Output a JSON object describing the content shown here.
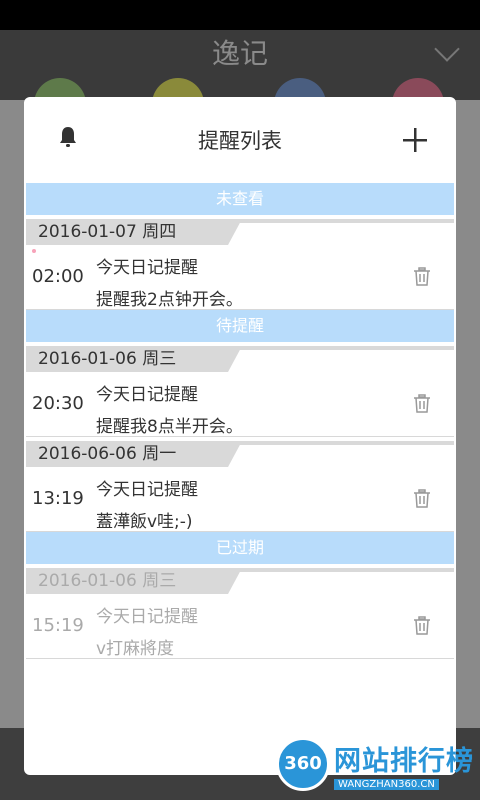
{
  "app": {
    "title": "逸记"
  },
  "dialog": {
    "title": "提醒列表"
  },
  "sections": [
    {
      "label": "未查看",
      "groups": [
        {
          "date": "2016-01-07 周四",
          "items": [
            {
              "time": "02:00",
              "title": "今天日记提醒",
              "desc": "提醒我2点钟开会。"
            }
          ]
        }
      ]
    },
    {
      "label": "待提醒",
      "groups": [
        {
          "date": "2016-01-06 周三",
          "items": [
            {
              "time": "20:30",
              "title": "今天日记提醒",
              "desc": "提醒我8点半开会。"
            }
          ]
        },
        {
          "date": "2016-06-06 周一",
          "items": [
            {
              "time": "13:19",
              "title": "今天日记提醒",
              "desc": "蓋澕飯v哇;-)"
            }
          ]
        }
      ]
    },
    {
      "label": "已过期",
      "groups": [
        {
          "date": "2016-01-06 周三",
          "items": [
            {
              "time": "15:19",
              "title": "今天日记提醒",
              "desc": "v打麻將度"
            }
          ]
        }
      ]
    }
  ],
  "watermark": {
    "badge": "360",
    "text": "网站排行榜",
    "url": "WANGZHAN360.CN"
  },
  "colors": {
    "section_bg": "#b8dcfb",
    "date_tab_bg": "#d9d9d9",
    "watermark_blue": "#2a95d8"
  }
}
